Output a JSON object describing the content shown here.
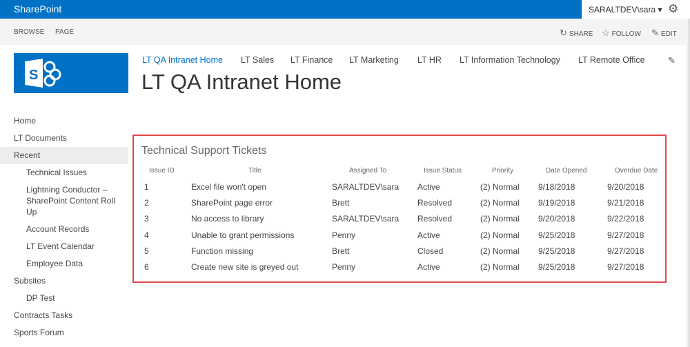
{
  "topbar": {
    "brand": "SharePoint",
    "user": "SARALTDEV\\sara ▾",
    "gear_icon": "gear-icon"
  },
  "ribbon": {
    "tabs": [
      "BROWSE",
      "PAGE"
    ],
    "actions": [
      {
        "icon": "↻",
        "label": "SHARE"
      },
      {
        "icon": "☆",
        "label": "FOLLOW"
      },
      {
        "icon": "✎",
        "label": "EDIT"
      }
    ]
  },
  "topnav": [
    "LT QA Intranet Home",
    "LT Sales",
    "LT Finance",
    "LT Marketing",
    "LT HR",
    "LT Information Technology",
    "LT Remote Office"
  ],
  "page_title": "LT QA Intranet Home",
  "quicklaunch": [
    "Home",
    "LT Documents",
    "Recent",
    "Technical Issues",
    "Lightning Conductor – SharePoint Content Roll Up",
    "Account Records",
    "LT Event Calendar",
    "Employee Data",
    "Subsites",
    "DP Test",
    "Contracts Tasks",
    "Sports Forum"
  ],
  "webpart": {
    "title": "Technical Support Tickets",
    "columns": [
      "Issue ID",
      "Title",
      "Assigned To",
      "Issue Status",
      "Priority",
      "Date Opened",
      "Overdue Date"
    ],
    "rows": [
      [
        "1",
        "Excel file won't open",
        "SARALTDEV\\sara",
        "Active",
        "(2) Normal",
        "9/18/2018",
        "9/20/2018"
      ],
      [
        "2",
        "SharePoint page error",
        "Brett",
        "Resolved",
        "(2) Normal",
        "9/19/2018",
        "9/21/2018"
      ],
      [
        "3",
        "No access to library",
        "SARALTDEV\\sara",
        "Resolved",
        "(2) Normal",
        "9/20/2018",
        "9/22/2018"
      ],
      [
        "4",
        "Unable to grant permissions",
        "Penny",
        "Active",
        "(2) Normal",
        "9/25/2018",
        "9/27/2018"
      ],
      [
        "5",
        "Function missing",
        "Brett",
        "Closed",
        "(2) Normal",
        "9/25/2018",
        "9/27/2018"
      ],
      [
        "6",
        "Create new site is greyed out",
        "Penny",
        "Active",
        "(2) Normal",
        "9/25/2018",
        "9/27/2018"
      ]
    ]
  }
}
